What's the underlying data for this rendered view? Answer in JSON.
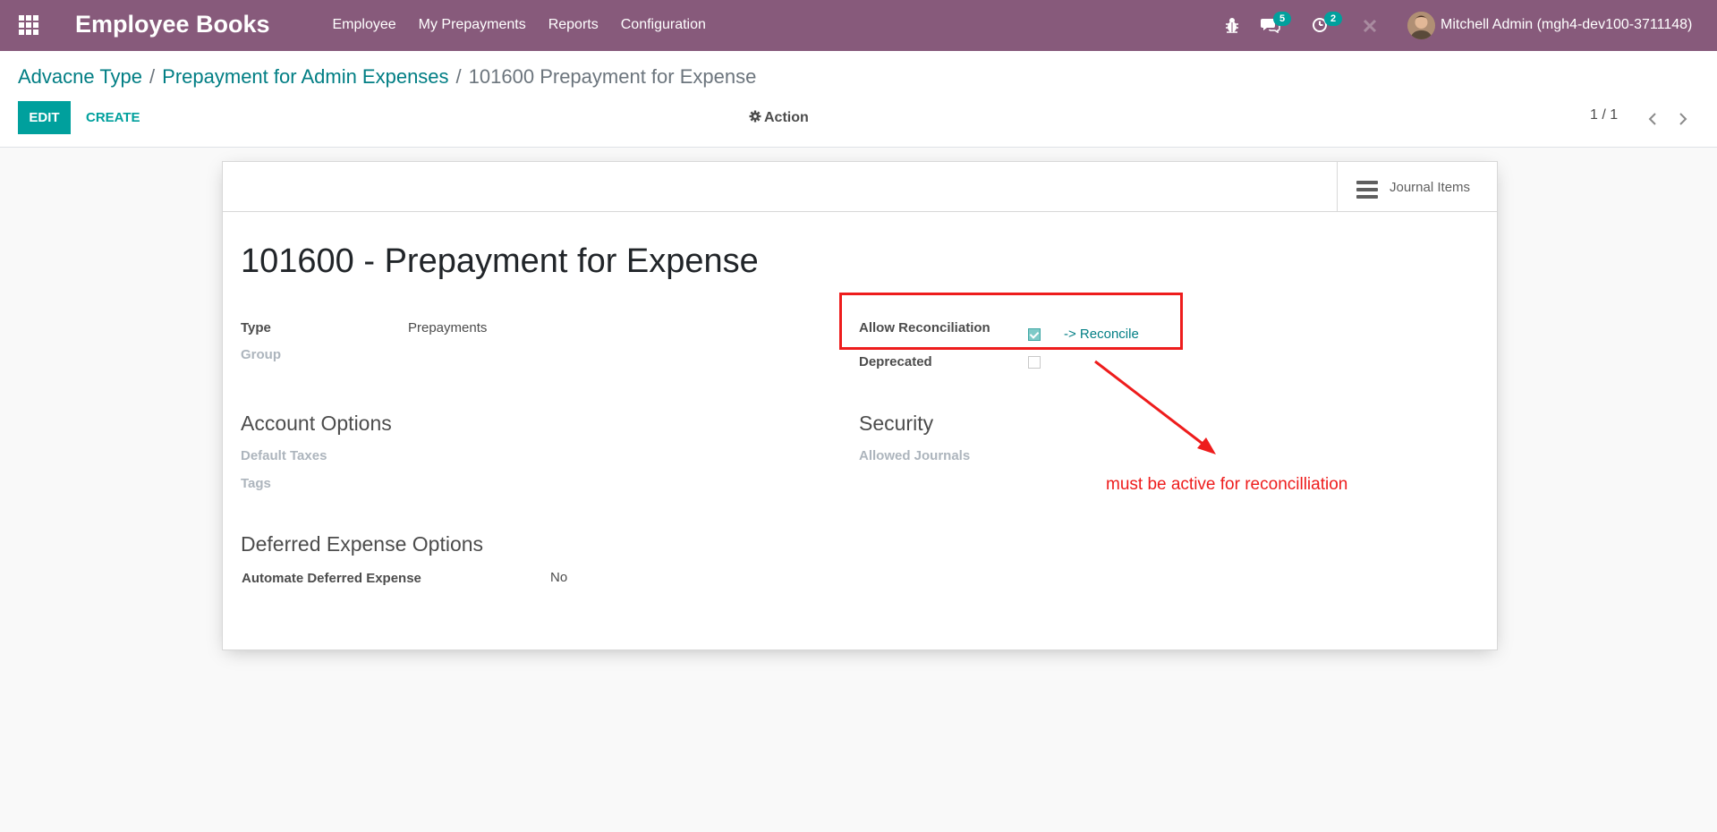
{
  "navbar": {
    "brand": "Employee Books",
    "menu": [
      "Employee",
      "My Prepayments",
      "Reports",
      "Configuration"
    ],
    "messages_count": "5",
    "activities_count": "2",
    "user": "Mitchell Admin (mgh4-dev100-3711148)",
    "bg_color": "#875a7b"
  },
  "breadcrumb": {
    "items": [
      "Advacne Type",
      "Prepayment for Admin Expenses"
    ],
    "current": "101600 Prepayment for Expense",
    "separator": "/"
  },
  "control": {
    "edit": "EDIT",
    "create": "CREATE",
    "action": "Action",
    "pager": "1 / 1"
  },
  "form": {
    "smart_button": "Journal Items",
    "title": "101600 - Prepayment for Expense",
    "type_label": "Type",
    "type_value": "Prepayments",
    "group_label": "Group",
    "allow_reconciliation_label": "Allow Reconciliation",
    "allow_reconciliation_checked": true,
    "reconcile_link": "-> Reconcile",
    "deprecated_label": "Deprecated",
    "deprecated_checked": false,
    "account_options_title": "Account Options",
    "default_taxes_label": "Default Taxes",
    "tags_label": "Tags",
    "security_title": "Security",
    "allowed_journals_label": "Allowed Journals",
    "deferred_title": "Deferred Expense Options",
    "automate_label": "Automate Deferred Expense",
    "automate_value": "No"
  },
  "annotation": {
    "text": "must be active for reconcilliation",
    "color": "#ee1c1c"
  },
  "accent_color": "#00a09d"
}
